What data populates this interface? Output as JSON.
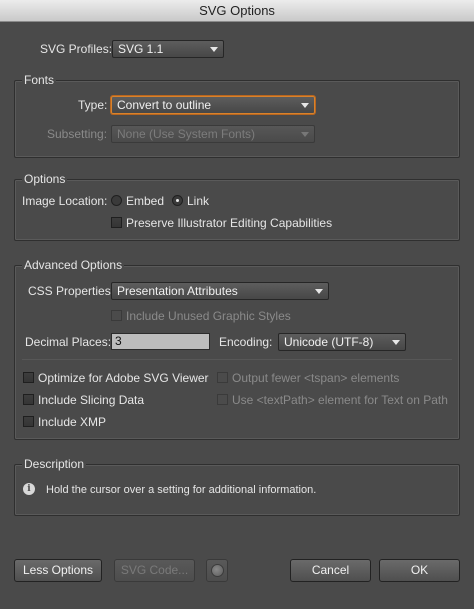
{
  "window": {
    "title": "SVG Options"
  },
  "profiles": {
    "label": "SVG Profiles:",
    "value": "SVG 1.1"
  },
  "fonts": {
    "title": "Fonts",
    "type_label": "Type:",
    "type_value": "Convert to outline",
    "subsetting_label": "Subsetting:",
    "subsetting_value": "None (Use System Fonts)"
  },
  "options": {
    "title": "Options",
    "image_location_label": "Image Location:",
    "embed_label": "Embed",
    "link_label": "Link",
    "image_location_selected": "Link",
    "preserve_label": "Preserve Illustrator Editing Capabilities"
  },
  "advanced": {
    "title": "Advanced Options",
    "css_label": "CSS Properties:",
    "css_value": "Presentation Attributes",
    "unused_styles_label": "Include Unused Graphic Styles",
    "decimal_label": "Decimal Places:",
    "decimal_value": "3",
    "encoding_label": "Encoding:",
    "encoding_value": "Unicode (UTF-8)",
    "optimize_label": "Optimize for Adobe SVG Viewer",
    "slicing_label": "Include Slicing Data",
    "xmp_label": "Include XMP",
    "tspan_label": "Output fewer <tspan> elements",
    "textpath_label": "Use <textPath> element for Text on Path"
  },
  "description": {
    "title": "Description",
    "text": "Hold the cursor over a setting for additional information."
  },
  "buttons": {
    "less_options": "Less Options",
    "svg_code": "SVG Code...",
    "cancel": "Cancel",
    "ok": "OK"
  }
}
